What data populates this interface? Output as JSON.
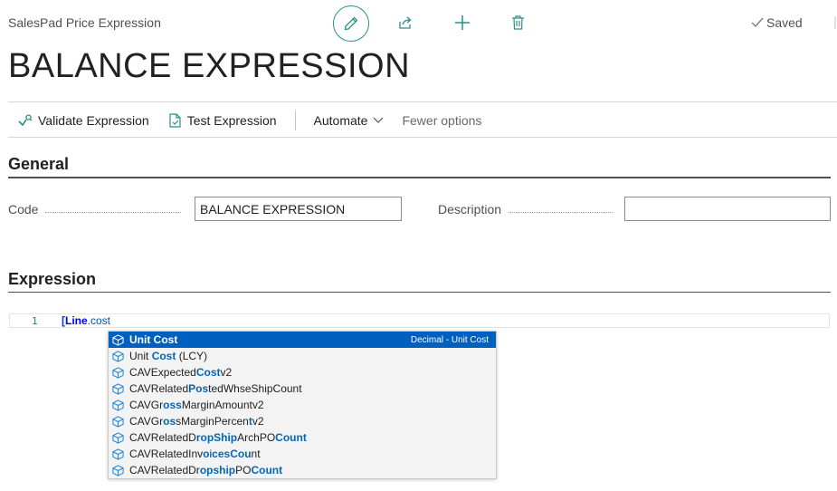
{
  "caption": "SalesPad Price Expression",
  "toolbar_icons": [
    "pencil-icon",
    "share-icon",
    "plus-icon",
    "trash-icon"
  ],
  "saved_label": "Saved",
  "title": "BALANCE EXPRESSION",
  "actions": {
    "validate": "Validate Expression",
    "test": "Test Expression",
    "automate": "Automate",
    "fewer": "Fewer options"
  },
  "general": {
    "heading": "General",
    "code_label": "Code",
    "code_value": "BALANCE EXPRESSION",
    "description_label": "Description",
    "description_value": ""
  },
  "expression": {
    "heading": "Expression",
    "line_number": "1",
    "code_bracket": "[",
    "code_keyword": "Line",
    "code_member": ".cost"
  },
  "suggestions": {
    "selected_detail": "Decimal - Unit Cost",
    "items": [
      {
        "segments": [
          [
            "Unit ",
            true
          ],
          [
            "Cost",
            true
          ]
        ]
      },
      {
        "segments": [
          [
            "Unit ",
            false
          ],
          [
            "Cost",
            true
          ],
          [
            " (LCY)",
            false
          ]
        ]
      },
      {
        "segments": [
          [
            "CAVExpected",
            false
          ],
          [
            "Cost",
            true
          ],
          [
            "v2",
            false
          ]
        ]
      },
      {
        "segments": [
          [
            "CAVRelated",
            false
          ],
          [
            "Pos",
            true
          ],
          [
            "tedWhseShipCount",
            false
          ]
        ]
      },
      {
        "segments": [
          [
            "CAVGr",
            false
          ],
          [
            "oss",
            true
          ],
          [
            "MarginAmount",
            false
          ],
          [
            "v",
            false
          ],
          [
            "2",
            false
          ]
        ]
      },
      {
        "segments": [
          [
            "CAVGr",
            false
          ],
          [
            "os",
            true
          ],
          [
            "sMarginPercen",
            false
          ],
          [
            "t",
            true
          ],
          [
            "v2",
            false
          ]
        ]
      },
      {
        "segments": [
          [
            "CAVRelatedD",
            false
          ],
          [
            "ropShip",
            true
          ],
          [
            "ArchPO",
            false
          ],
          [
            "Count",
            true
          ]
        ]
      },
      {
        "segments": [
          [
            "CAVRelatedInv",
            false
          ],
          [
            "o",
            true
          ],
          [
            "i",
            false
          ],
          [
            "cesCou",
            true
          ],
          [
            "nt",
            false
          ]
        ]
      },
      {
        "segments": [
          [
            "CAVRelatedDr",
            false
          ],
          [
            "opship",
            true
          ],
          [
            "PO",
            false
          ],
          [
            "Count",
            true
          ]
        ]
      }
    ]
  },
  "colors": {
    "accent": "#2a8f8a",
    "selection": "#0060c0",
    "highlight": "#0066bf"
  }
}
